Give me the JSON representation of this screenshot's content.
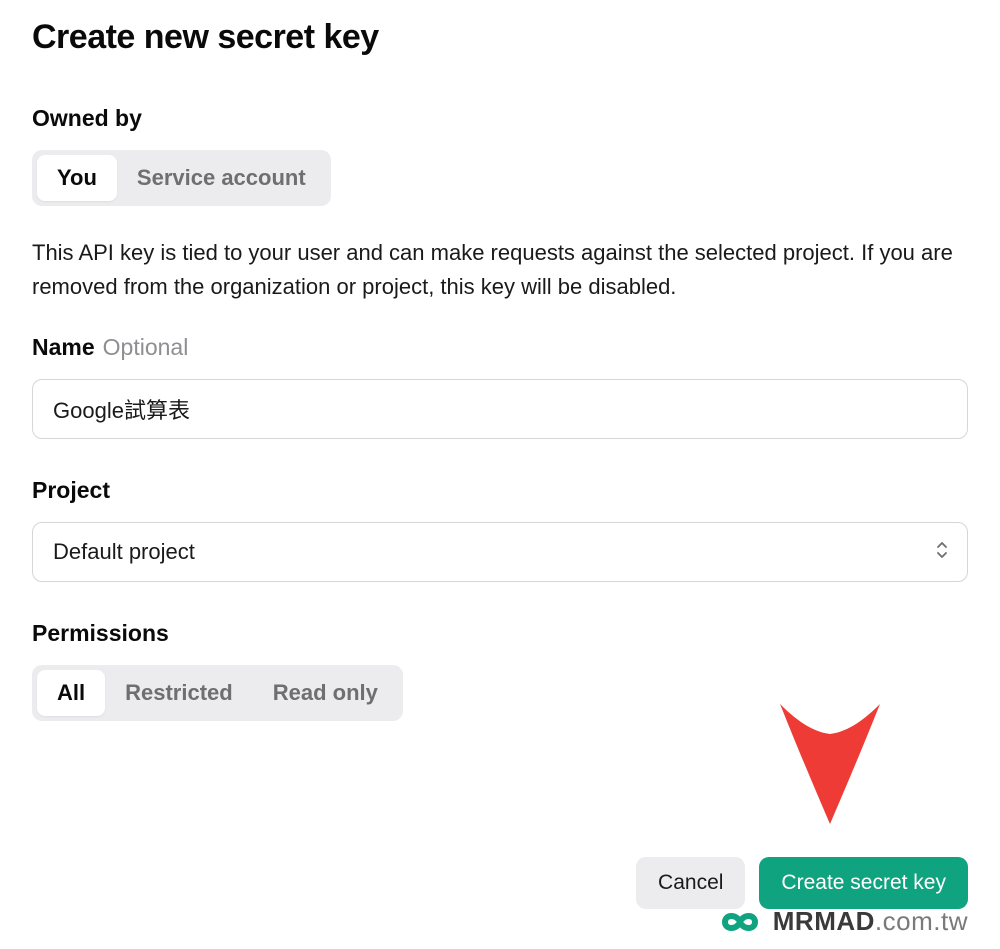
{
  "title": "Create new secret key",
  "owned_by": {
    "label": "Owned by",
    "options": [
      "You",
      "Service account"
    ],
    "active": "You"
  },
  "description": "This API key is tied to your user and can make requests against the selected project. If you are removed from the organization or project, this key will be disabled.",
  "name": {
    "label": "Name",
    "optional_tag": "Optional",
    "value": "Google試算表"
  },
  "project": {
    "label": "Project",
    "selected": "Default project"
  },
  "permissions": {
    "label": "Permissions",
    "options": [
      "All",
      "Restricted",
      "Read only"
    ],
    "active": "All"
  },
  "actions": {
    "cancel": "Cancel",
    "create": "Create secret key"
  },
  "watermark": {
    "brand": "MRMAD",
    "domain": ".com.tw"
  },
  "annotation": {
    "arrow_color": "#ef3b36"
  }
}
